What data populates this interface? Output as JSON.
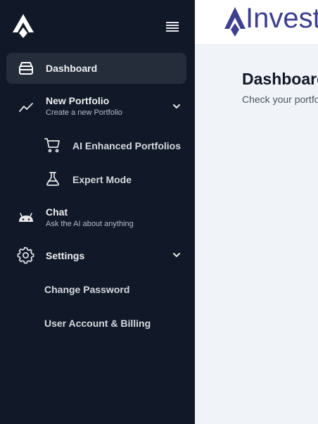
{
  "sidebar": {
    "menu_icon": "hamburger-icon",
    "items": [
      {
        "label": "Dashboard",
        "icon": "archive-box-icon",
        "active": true
      },
      {
        "label": "New Portfolio",
        "sublabel": "Create a new Portfolio",
        "icon": "trend-line-icon",
        "expanded": true
      },
      {
        "label": "AI Enhanced Portfolios",
        "icon": "cart-icon"
      },
      {
        "label": "Expert Mode",
        "icon": "flask-icon"
      },
      {
        "label": "Chat",
        "sublabel": "Ask the AI about anything",
        "icon": "android-icon"
      },
      {
        "label": "Settings",
        "icon": "gear-icon",
        "expanded": true
      },
      {
        "label": "Change Password"
      },
      {
        "label": "User Account & Billing"
      }
    ]
  },
  "header": {
    "brand_text": "Invest"
  },
  "main": {
    "title": "Dashboard",
    "subtitle": "Check your portfolio"
  },
  "colors": {
    "sidebar_bg": "#111827",
    "active_bg": "#252d3b",
    "brand": "#3d3f91",
    "content_bg": "#f0f3f8"
  }
}
